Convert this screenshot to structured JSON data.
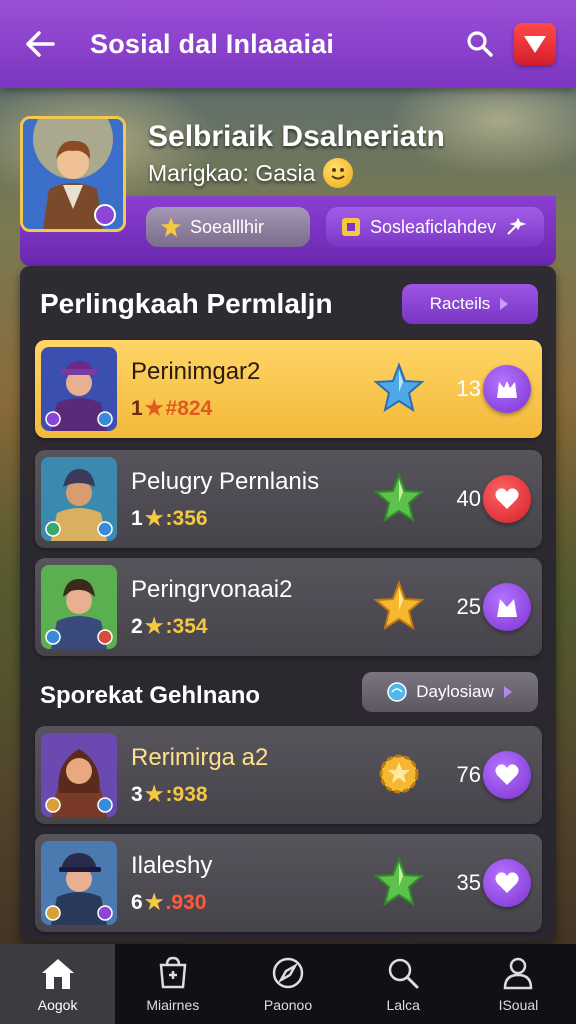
{
  "header": {
    "title": "Sosial dal Inlaaaiai"
  },
  "profile": {
    "name": "Selbriaik Dsalneriatn",
    "subtitle": "Marigkao: Gasia",
    "button_left": "Soealllhir",
    "button_right": "Sosleaficlahdev"
  },
  "section1": {
    "title": "Perlingkaah Permlaljn",
    "link": "Racteils"
  },
  "section2": {
    "title": "Sporekat Gehlnano",
    "link": "Daylosiaw"
  },
  "rows": [
    {
      "name": "Perinimgar2",
      "rank": "1",
      "score": "#824",
      "count": "13",
      "badge_icon": "blue-star-icon",
      "action_icon": "purple-crown-badge-icon"
    },
    {
      "name": "Pelugry Pernlanis",
      "rank": "1",
      "score": ":356",
      "count": "40",
      "badge_icon": "green-star-icon",
      "action_icon": "red-heart-icon"
    },
    {
      "name": "Peringrvonaai2",
      "rank": "2",
      "score": ":354",
      "count": "25",
      "badge_icon": "gold-star-icon",
      "action_icon": "purple-star-badge-icon"
    },
    {
      "name": "Rerimirga a2",
      "rank": "3",
      "score": ":938",
      "count": "76",
      "badge_icon": "gold-gear-star-icon",
      "action_icon": "purple-heart-icon"
    },
    {
      "name": "Ilaleshy",
      "rank": "6",
      "score": ".930",
      "count": "35",
      "badge_icon": "green-star-icon",
      "action_icon": "purple-heart-icon"
    }
  ],
  "nav": [
    {
      "label": "Aogok",
      "icon": "home-icon"
    },
    {
      "label": "Miairnes",
      "icon": "shop-icon"
    },
    {
      "label": "Paonoo",
      "icon": "compass-icon"
    },
    {
      "label": "Lalca",
      "icon": "search-icon"
    },
    {
      "label": "ISoual",
      "icon": "profile-icon"
    }
  ],
  "colors": {
    "header": "#8a41cc",
    "highlight_row": "#f7c34a",
    "panel": "#29272f",
    "accent_purple": "#8e45d8",
    "heart_red": "#e0232e"
  }
}
